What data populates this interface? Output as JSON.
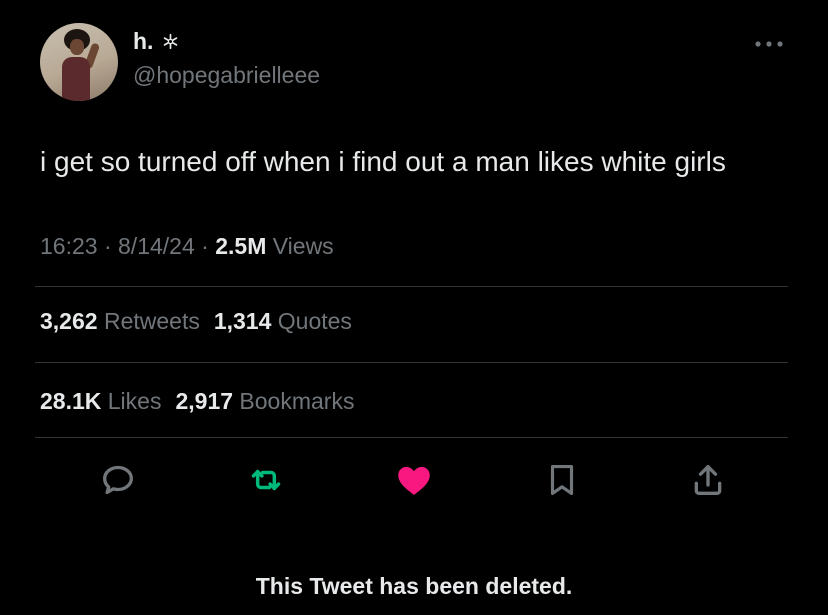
{
  "author": {
    "display_name": "h.",
    "handle": "@hopegabrielleee",
    "badge_icon": "snowflake-icon"
  },
  "tweet": {
    "text": "i get so turned off when i find out a man likes white girls",
    "time": "16:23",
    "separator": "·",
    "date": "8/14/24",
    "views_count": "2.5M",
    "views_label": "Views"
  },
  "stats": {
    "retweets_count": "3,262",
    "retweets_label": "Retweets",
    "quotes_count": "1,314",
    "quotes_label": "Quotes",
    "likes_count": "28.1K",
    "likes_label": "Likes",
    "bookmarks_count": "2,917",
    "bookmarks_label": "Bookmarks"
  },
  "actions": {
    "reply_icon": "speech-bubble-icon",
    "retweet_icon": "retweet-arrows-icon",
    "like_icon": "heart-icon",
    "bookmark_icon": "bookmark-icon",
    "share_icon": "share-upload-icon"
  },
  "colors": {
    "background": "#000000",
    "primary_text": "#e7e9ea",
    "secondary_text": "#71767b",
    "retweet_active": "#00ba7c",
    "like_active": "#f91880",
    "divider": "#2f3336"
  },
  "quoted_tweet_notice": "This Tweet has been deleted."
}
